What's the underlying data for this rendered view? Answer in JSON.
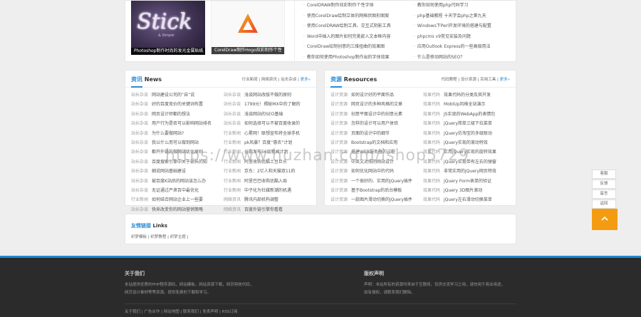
{
  "top": {
    "thumbs": [
      {
        "caption": "Photoshop制作时尚的发光金属贴纸",
        "image_text": "Stick",
        "image_sub": "& Simple"
      },
      {
        "caption": "CorelDraw制作Hogo炫彩制作个性"
      }
    ],
    "list_left": [
      "CorelDRAW制作炫彩制作个性字体",
      "使用CorelDraw绘制立体的网格状图形图案",
      "使用CorelDRAW绘制工具、交互式阴影工具",
      "Word中插入的图片如何完美嵌入文本框内容",
      "CorelDraw绘制创意的三维扭曲的效果图",
      "教你如何使用Photoshop制作出的字体效果"
    ],
    "list_right": [
      "教你如何使用php代码学习",
      "php基础教程 十天学会php之第九天",
      "Windows下Perl开发环境的搭建与配置",
      "phpcms v9常见安装及问题",
      "应用Outlook Express的一些高级用法",
      "什么是移动网站的SEO？"
    ]
  },
  "news": {
    "title_cn": "资讯",
    "title_en": "News",
    "tags": "行业新闻 | 网络资讯 | 站长杂谈 | ",
    "more": "更多»",
    "rows": [
      [
        "站长杂谈",
        "网站建设公司的“自”说",
        "站长杂谈",
        "浅谈网站改版不做的原则"
      ],
      [
        "站长杂谈",
        "好的百度竞价的关键词布置",
        "站长杂谈",
        "1799元！揭秘MX中的了解的"
      ],
      [
        "站长杂谈",
        "网页设计师都的想法",
        "站长杂谈",
        "浅谈网站的SEO基础"
      ],
      [
        "站长杂谈",
        "用户行为是否可以影响网站排名",
        "站长杂谈",
        "如何选择可以不被百度收录的"
      ],
      [
        "站长杂谈",
        "为什么要做网站?",
        "行业新闻",
        "心累网！联想宣布将全球手机"
      ],
      [
        "站长杂谈",
        "我以什么而可以做到网站",
        "行业新闻",
        "pk风暴？百度“惠农”计划"
      ],
      [
        "站长杂谈",
        "都开外链的做网站优化原则",
        "行业新闻",
        "谷歌发布56层新闻计划"
      ],
      [
        "站长杂谈",
        "百度搜索引擎中关于站长的知",
        "行业新闻",
        "阿里收购优酷土豆巨头"
      ],
      [
        "站长杂谈",
        "细说网站基础建设",
        "行业新闻",
        "京东：2亿人和天猫双11的"
      ],
      [
        "站长杂谈",
        "被百度K站后的网站该怎么办",
        "行业新闻",
        "阿里巴巴收购优酷入局"
      ],
      [
        "站长杂谈",
        "无证通过严肃百中最优化",
        "行业新闻",
        "中子化为社媒新潮的机遇"
      ],
      [
        "行业新闻",
        "如何结合网站企业上一些要",
        "网络资讯",
        "腾讯内部机构调整"
      ],
      [
        "站长杂谈",
        "快来改变你的网站营销策略",
        "网络资讯",
        "百度外链引擎你看看"
      ]
    ]
  },
  "resources": {
    "title_cn": "资源",
    "title_en": "Resources",
    "tags": "代码教程 | 设计资源 | 实用工具 | ",
    "more": "更多»",
    "rows": [
      [
        "设计资源",
        "如何设计好的平面作品",
        "效果代码",
        "效果代码的分类及其开发"
      ],
      [
        "设计资源",
        "网页设计的多种风格的文章",
        "效果代码",
        "MoblUp风格全站演示"
      ],
      [
        "设计资源",
        "创意平面设计中的创意元素",
        "效果代码",
        "JS实现的WebApp的表情包"
      ],
      [
        "设计资源",
        "怎样的设计可以用户体验",
        "效果代码",
        "jQuery简单三级下拉菜单"
      ],
      [
        "设计资源",
        "页面的设计中的细节",
        "效果代码",
        "jQuery仿淘宝的多级联动"
      ],
      [
        "设计资源",
        "Bootstrap的文档和应用",
        "效果代码",
        "jQuery实现的滚动特效"
      ],
      [
        "设计资源",
        "搭建WEB服务器的过程",
        "效果代码",
        "实用jQuery实现的旋转效果"
      ],
      [
        "设计资源",
        "中英文对照的网站设计",
        "效果代码",
        "jQuery实现带有左右的弹窗"
      ],
      [
        "设计资源",
        "如何优化网站中的代码",
        "效果代码",
        "非常实用的jQuery网页特效"
      ],
      [
        "设计资源",
        "一个很好的、实用的jQuery插件",
        "效果代码",
        "jQuery Form表单的验证"
      ],
      [
        "设计资源",
        "基于Bootstrap的后台模板",
        "效果代码",
        "jQuery 3D图片滚动"
      ],
      [
        "设计资源",
        "一款图片滑动切换的jQuery插件",
        "效果代码",
        "jQuery左右滑动切换菜单"
      ]
    ]
  },
  "links": {
    "title_cn": "友情链接",
    "title_en": "Links",
    "items": "织梦模板 | 织梦教程 | 织梦主题 | "
  },
  "footer": {
    "about_title": "关于我们",
    "about_text_1": "本站提供优质的PHP程序源码，网站模板，网站资源下载，网页特效代码，",
    "about_text_2": "网页设计素材等等资源。提供免费的下载和学习。",
    "copyright_title": "版权声明",
    "copyright_text_1": "声明：本站所有的资源均来自于互联网，仅供交流学习之用，请勿用于商业用途，",
    "copyright_text_2": "如有侵权，请联系我们删除。",
    "bottom_links": "关于我们 | 广告合作 | 网站地图 | 联系我们 | 免责声明 | RSS订阅"
  },
  "side": {
    "buttons": [
      "客服",
      "反馈",
      "留言",
      "返回"
    ]
  },
  "watermark": "https://www.huzhan.com/ishop5729"
}
